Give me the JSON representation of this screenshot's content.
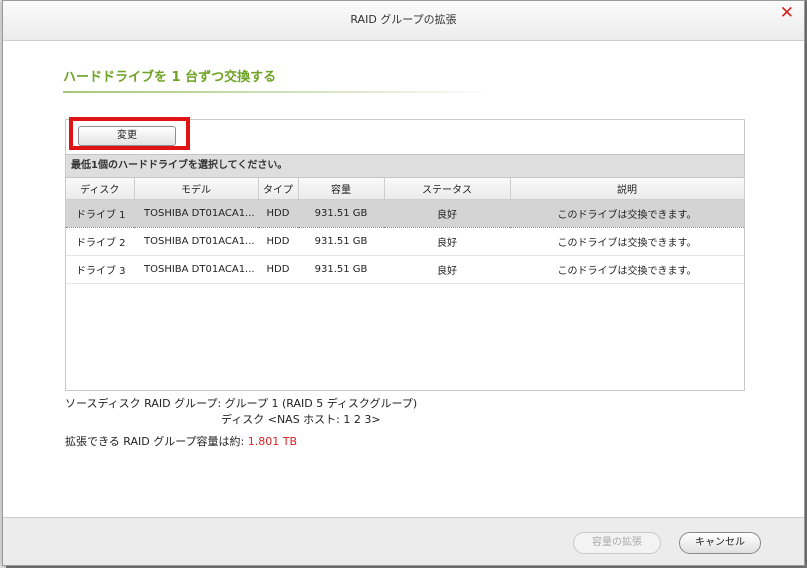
{
  "dialog": {
    "title": "RAID グループの拡張",
    "close_icon": "close-icon"
  },
  "section": {
    "title": "ハードドライブを 1 台ずつ交換する"
  },
  "toolbar": {
    "change_label": "変更"
  },
  "grid": {
    "caption": "最低1個のハードドライブを選択してください。",
    "columns": [
      "ディスク",
      "モデル",
      "タイプ",
      "容量",
      "ステータス",
      "説明"
    ],
    "rows": [
      {
        "disk": "ドライブ 1",
        "model": "TOSHIBA DT01ACA1...",
        "type": "HDD",
        "capacity": "931.51 GB",
        "status": "良好",
        "desc": "このドライブは交換できます。",
        "selected": true
      },
      {
        "disk": "ドライブ 2",
        "model": "TOSHIBA DT01ACA1...",
        "type": "HDD",
        "capacity": "931.51 GB",
        "status": "良好",
        "desc": "このドライブは交換できます。",
        "selected": false
      },
      {
        "disk": "ドライブ 3",
        "model": "TOSHIBA DT01ACA1...",
        "type": "HDD",
        "capacity": "931.51 GB",
        "status": "良好",
        "desc": "このドライブは交換できます。",
        "selected": false
      }
    ]
  },
  "info": {
    "source_line": "ソースディスク RAID グループ: グループ 1 (RAID 5 ディスクグループ)",
    "disk_line": "ディスク <NAS ホスト: 1 2 3>",
    "capacity_label": "拡張できる RAID グループ容量は約: ",
    "capacity_value": "1.801 TB",
    "capacity_color": "#dd2222"
  },
  "footer": {
    "expand_label": "容量の拡張",
    "cancel_label": "キャンセル"
  },
  "colors": {
    "accent_green": "#6ea324",
    "highlight_red": "#e01414"
  }
}
